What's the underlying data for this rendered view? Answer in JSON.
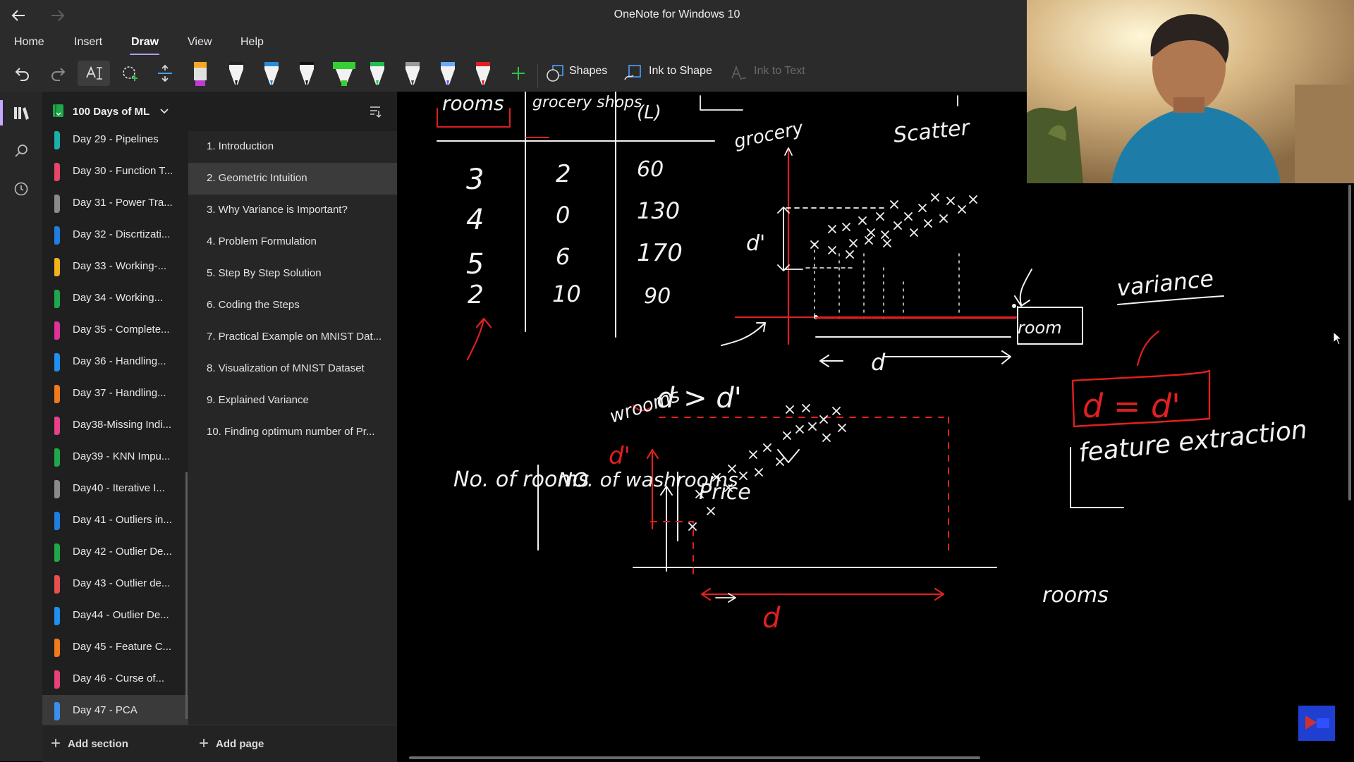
{
  "window": {
    "title": "OneNote for Windows 10",
    "back_icon": "back-arrow-icon",
    "forward_icon": "forward-arrow-icon"
  },
  "menu": {
    "items": [
      "Home",
      "Insert",
      "Draw",
      "View",
      "Help"
    ],
    "active": "Draw",
    "accent": "#b69ce8"
  },
  "toolbar": {
    "shapes_label": "Shapes",
    "ink_to_shape_label": "Ink to Shape",
    "ink_to_text_label": "Ink to Text",
    "pens": [
      {
        "name": "highlighter-orange-pen",
        "color": "#f5a623"
      },
      {
        "name": "black-pen-1",
        "color": "#1a1a1a"
      },
      {
        "name": "blue-pen",
        "color": "#2a8bd8"
      },
      {
        "name": "black-pen-2",
        "color": "#1a1a1a"
      },
      {
        "name": "green-highlighter",
        "color": "#35d035"
      },
      {
        "name": "green-pen",
        "color": "#1fbf4f"
      },
      {
        "name": "gray-pen",
        "color": "#9a9a9a"
      },
      {
        "name": "light-blue-pen",
        "color": "#6aa8ff"
      },
      {
        "name": "red-pen",
        "color": "#e02020"
      }
    ]
  },
  "notebook": {
    "name": "100 Days of ML",
    "sections": [
      {
        "label": "Day 29 - Pipelines",
        "color": "#1db0a8"
      },
      {
        "label": "Day 30 - Function T...",
        "color": "#e8456a"
      },
      {
        "label": "Day 31 - Power Tra...",
        "color": "#8a8a8a"
      },
      {
        "label": "Day 32 - Discrtizati...",
        "color": "#1e7fe0"
      },
      {
        "label": "Day 33 - Working-...",
        "color": "#f2b21c"
      },
      {
        "label": "Day 34 - Working...",
        "color": "#1fa84a"
      },
      {
        "label": "Day 35 - Complete...",
        "color": "#e0309a"
      },
      {
        "label": "Day 36 - Handling...",
        "color": "#1e90f0"
      },
      {
        "label": "Day 37 - Handling...",
        "color": "#f07a1e"
      },
      {
        "label": "Day38-Missing Indi...",
        "color": "#e8408a"
      },
      {
        "label": "Day39 - KNN Impu...",
        "color": "#1fa84a"
      },
      {
        "label": "Day40 - Iterative I...",
        "color": "#8a8a8a"
      },
      {
        "label": "Day 41 - Outliers in...",
        "color": "#1e7fe0"
      },
      {
        "label": "Day 42 - Outlier De...",
        "color": "#1fa84a"
      },
      {
        "label": "Day 43 - Outlier de...",
        "color": "#e85050"
      },
      {
        "label": "Day44 - Outlier De...",
        "color": "#1e90f0"
      },
      {
        "label": "Day 45 - Feature C...",
        "color": "#f07a1e"
      },
      {
        "label": "Day 46 - Curse of...",
        "color": "#e8407a"
      },
      {
        "label": "Day 47 - PCA",
        "color": "#3a8ef0"
      }
    ],
    "active_section": "Day 47 - PCA",
    "pages": [
      "1. Introduction",
      "2. Geometric Intuition",
      "3. Why Variance is Important?",
      "4. Problem Formulation",
      "5. Step By Step Solution",
      "6. Coding the Steps",
      "7. Practical Example on MNIST Dat...",
      "8. Visualization of MNIST Dataset",
      "9. Explained Variance",
      "10. Finding optimum number of Pr..."
    ],
    "active_page": "2. Geometric Intuition",
    "add_section_label": "Add section",
    "add_page_label": "Add page"
  },
  "ink": {
    "table1": {
      "headers": [
        "rooms",
        "grocery shops",
        "(L)"
      ],
      "rows": [
        [
          "3",
          "2",
          "60"
        ],
        [
          "4",
          "0",
          "130"
        ],
        [
          "5",
          "6",
          "170"
        ],
        [
          "2",
          "10",
          "90"
        ]
      ]
    },
    "scatter_label": "Scatter",
    "grocery_label": "grocery",
    "room_label": "room",
    "d_label": "d",
    "d_prime_label": "d'",
    "d_gt_d_prime": "d > d'",
    "variance_label": "variance",
    "d_eq_d_prime": "d = d'",
    "feature_extraction_label": "feature extraction",
    "table2_headers": [
      "No. of rooms",
      "NO. of washrooms",
      "Price"
    ],
    "washrooms_label": "wrooms",
    "rooms_label": "rooms",
    "ink_colors": {
      "white": "#f2f2f2",
      "red": "#e02020"
    }
  }
}
